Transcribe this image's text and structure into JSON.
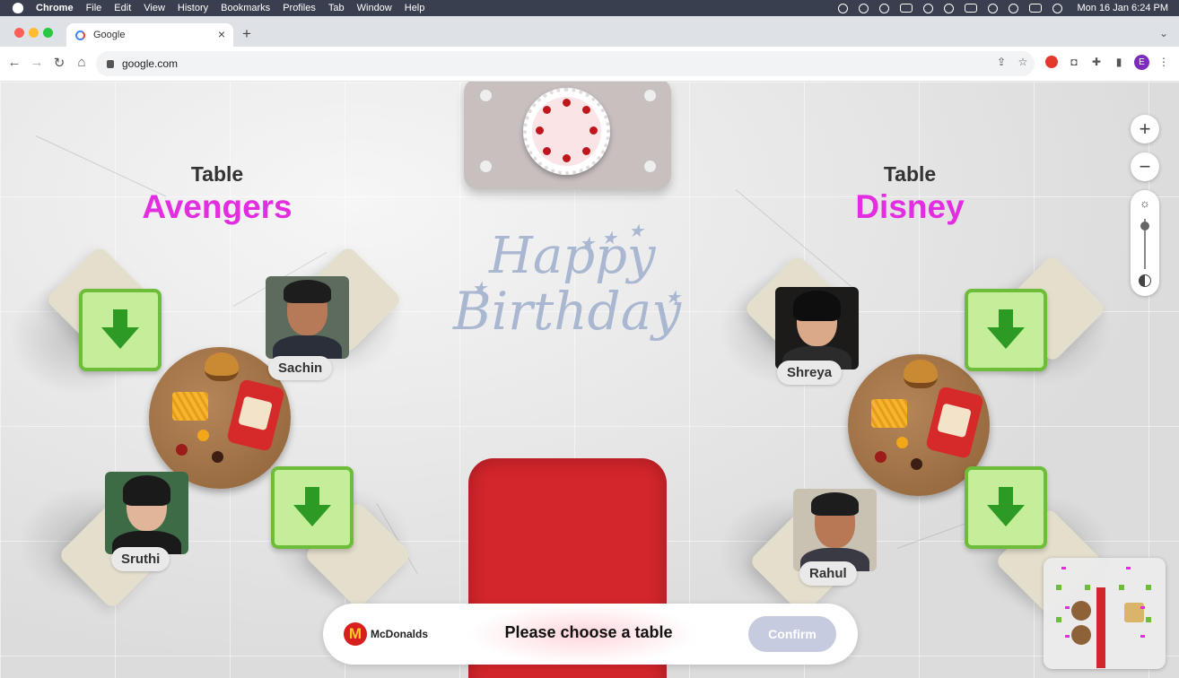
{
  "menubar": {
    "app": "Chrome",
    "items": [
      "File",
      "Edit",
      "View",
      "History",
      "Bookmarks",
      "Profiles",
      "Tab",
      "Window",
      "Help"
    ],
    "clock": "Mon 16 Jan  6:24 PM"
  },
  "browser": {
    "tab_title": "Google",
    "url": "google.com",
    "profile_initial": "E"
  },
  "tables": [
    {
      "label": "Table",
      "name": "Avengers",
      "guests": [
        "Sachin",
        "Sruthi"
      ]
    },
    {
      "label": "Table",
      "name": "Disney",
      "guests": [
        "Shreya",
        "Rahul"
      ]
    }
  ],
  "cake_card": {
    "decoration": "Happy Birthday"
  },
  "banner": {
    "line1": "Happy",
    "line2": "Birthday"
  },
  "footer": {
    "brand": "McDonalds",
    "brand_logo": "M",
    "prompt": "Please choose a table",
    "confirm_label": "Confirm"
  },
  "controls": {
    "zoom_in": "+",
    "zoom_out": "−",
    "brightness_icon": "☼"
  },
  "colors": {
    "table_name": "#e22ee0",
    "seat_fill": "#c4ee9a",
    "seat_border": "#6dbd3a",
    "carpet": "#d3252c",
    "confirm_disabled": "#c7cbe0"
  }
}
